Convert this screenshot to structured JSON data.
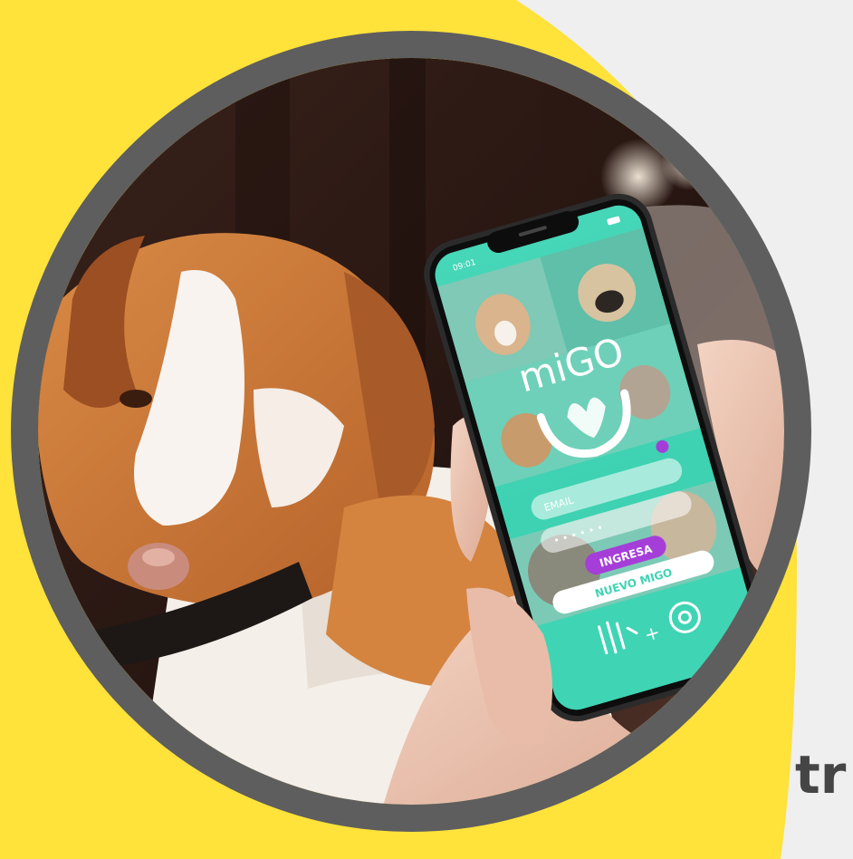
{
  "phone": {
    "status_time": "09:01",
    "app_name": "miGO",
    "email_placeholder": "EMAIL",
    "password_mask": "• • • • • •",
    "login_button": "INGRESA",
    "signup_button": "NUEVO MIGO"
  },
  "cut_text": "tr",
  "colors": {
    "yellow": "#ffe23a",
    "ring": "#5e5e5e",
    "app_teal": "#3fd4b4",
    "login_purple": "#a53ed8",
    "text_gray": "#454545"
  }
}
